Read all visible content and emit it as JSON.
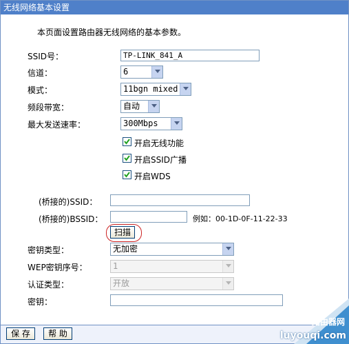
{
  "window": {
    "title": "无线网络基本设置"
  },
  "intro": "本页面设置路由器无线网络的基本参数。",
  "fields": {
    "ssid_label": "SSID号：",
    "ssid_value": "TP-LINK_841_A",
    "channel_label": "信道：",
    "channel_value": "6",
    "mode_label": "模式：",
    "mode_value": "11bgn mixed",
    "bandwidth_label": "频段带宽：",
    "bandwidth_value": "自动",
    "maxrate_label": "最大发送速率：",
    "maxrate_value": "300Mbps"
  },
  "checkboxes": {
    "wireless_enable": {
      "label": "开启无线功能",
      "checked": true
    },
    "ssid_broadcast": {
      "label": "开启SSID广播",
      "checked": true
    },
    "wds": {
      "label": "开启WDS",
      "checked": true
    }
  },
  "bridge": {
    "ssid_label": "(桥接的)SSID：",
    "ssid_value": "",
    "bssid_label": "(桥接的)BSSID：",
    "bssid_value": "",
    "example": "例如：00-1D-0F-11-22-33",
    "scan_label": "扫描"
  },
  "security": {
    "key_type_label": "密钥类型：",
    "key_type_value": "无加密",
    "wep_index_label": "WEP密钥序号：",
    "wep_index_value": "1",
    "auth_type_label": "认证类型：",
    "auth_type_value": "开放",
    "key_label": "密钥：",
    "key_value": ""
  },
  "footer": {
    "save_label": "保 存",
    "help_label": "帮 助"
  },
  "watermark": {
    "line1": "路由器网",
    "line2": "luyouqi.com"
  },
  "colors": {
    "titlebar": "#4f80c9",
    "frame": "#6f91c4",
    "scan_highlight": "#cc2222"
  }
}
